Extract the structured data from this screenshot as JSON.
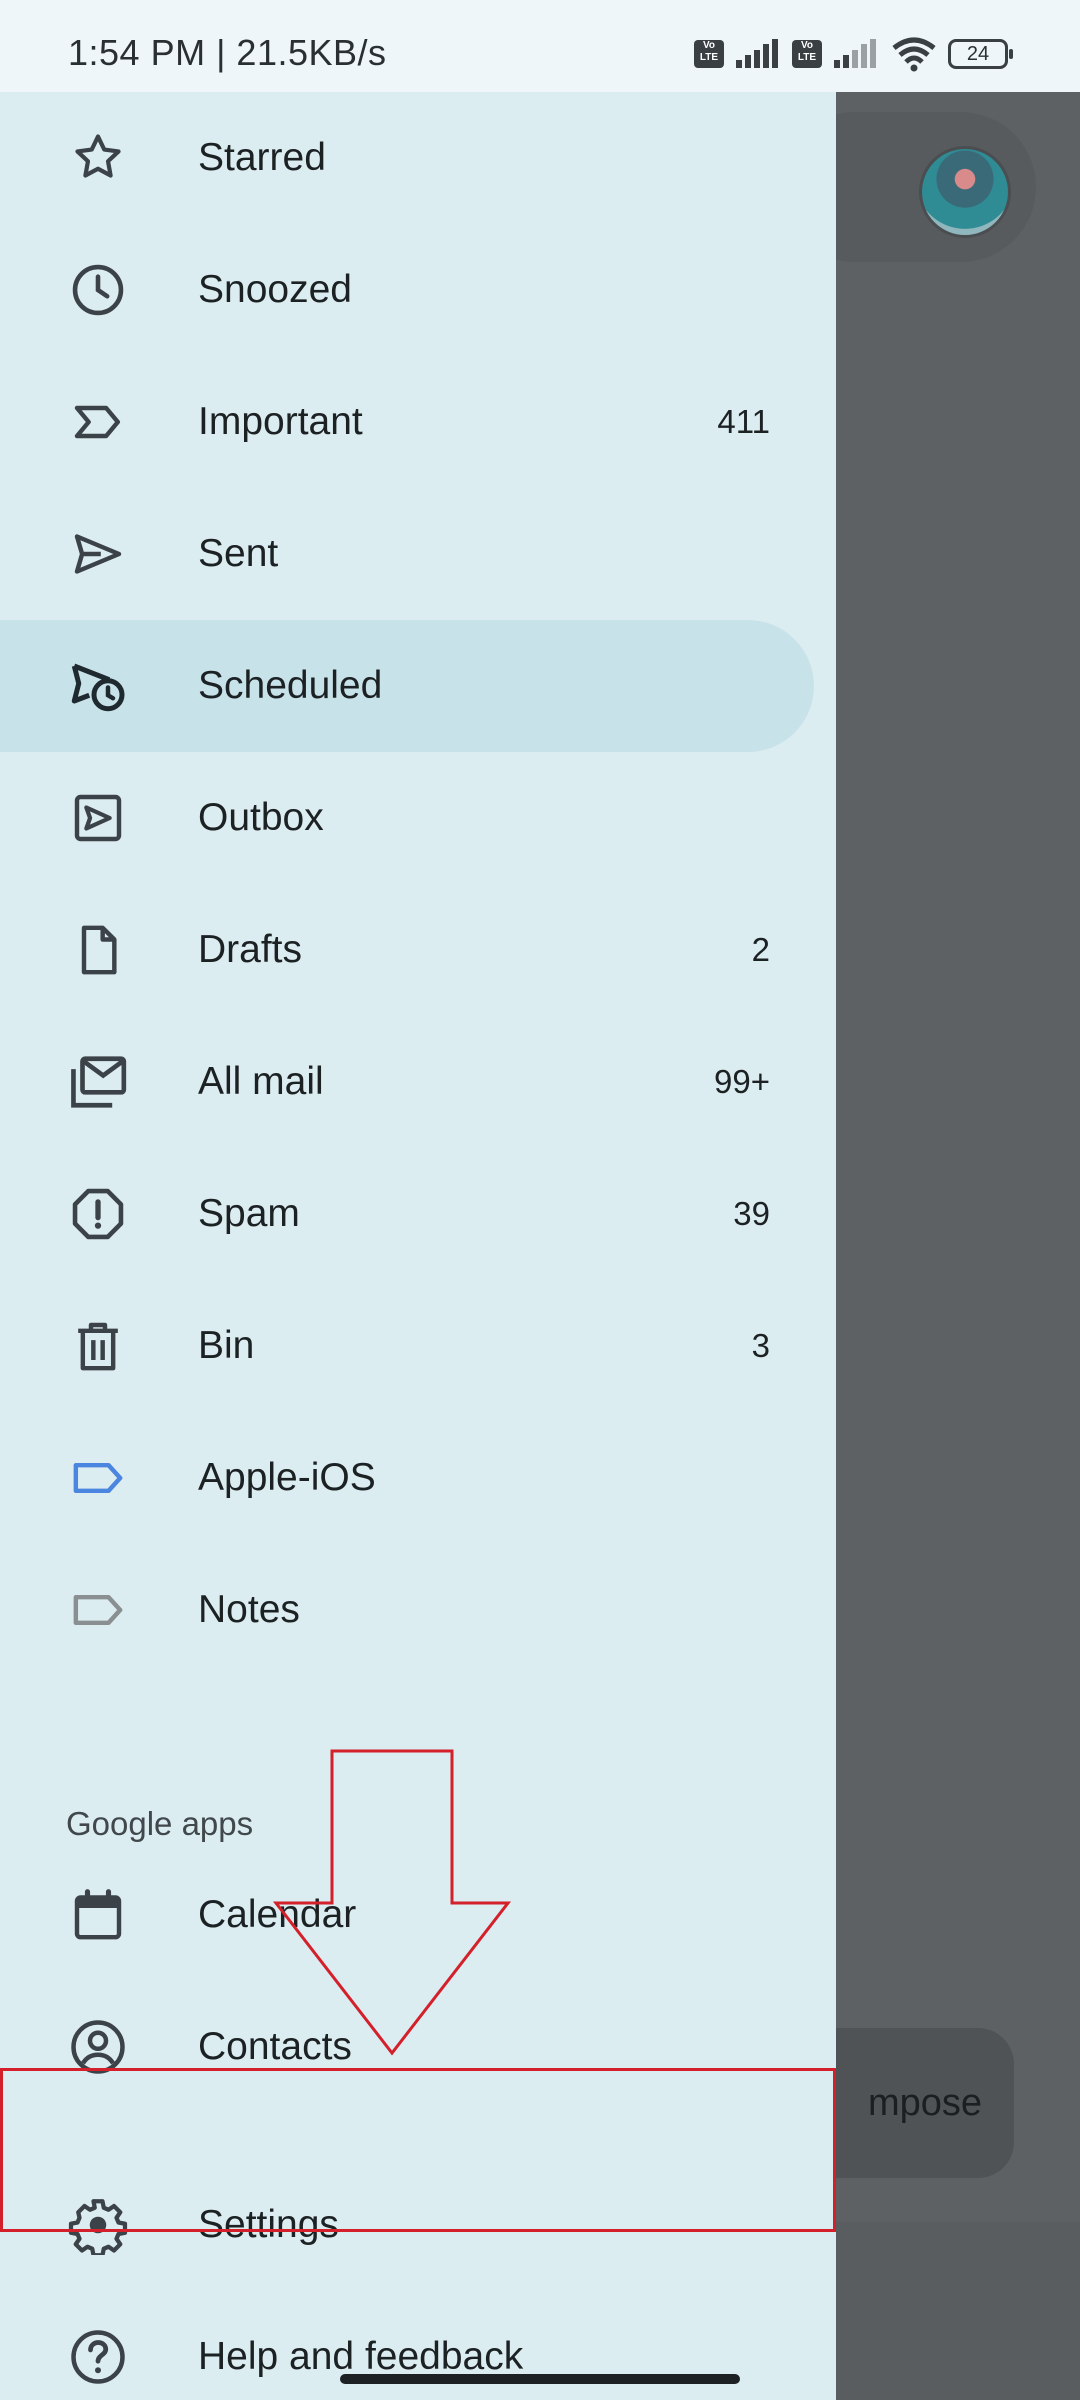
{
  "status_bar": {
    "time": "1:54 PM | 21.5KB/s",
    "lte1": "Vo LTE",
    "lte2": "Vo LTE",
    "battery": "24"
  },
  "drawer": {
    "items": [
      {
        "label": "Starred",
        "icon": "star-icon",
        "count": ""
      },
      {
        "label": "Snoozed",
        "icon": "clock-icon",
        "count": ""
      },
      {
        "label": "Important",
        "icon": "important-icon",
        "count": "411"
      },
      {
        "label": "Sent",
        "icon": "send-icon",
        "count": ""
      },
      {
        "label": "Scheduled",
        "icon": "scheduled-send-icon",
        "count": "",
        "selected": true
      },
      {
        "label": "Outbox",
        "icon": "outbox-icon",
        "count": ""
      },
      {
        "label": "Drafts",
        "icon": "draft-icon",
        "count": "2"
      },
      {
        "label": "All mail",
        "icon": "all-mail-icon",
        "count": "99+"
      },
      {
        "label": "Spam",
        "icon": "spam-icon",
        "count": "39"
      },
      {
        "label": "Bin",
        "icon": "trash-icon",
        "count": "3"
      },
      {
        "label": "Apple-iOS",
        "icon": "label-icon",
        "count": "",
        "color": "#4a86e0"
      },
      {
        "label": "Notes",
        "icon": "label-icon",
        "count": "",
        "color": "#8a8f92"
      }
    ],
    "section_title": "Google apps",
    "apps": [
      {
        "label": "Calendar",
        "icon": "calendar-icon"
      },
      {
        "label": "Contacts",
        "icon": "contacts-icon"
      },
      {
        "label": "Settings",
        "icon": "gear-icon"
      },
      {
        "label": "Help and feedback",
        "icon": "help-icon"
      }
    ]
  },
  "background": {
    "compose_label": "mpose"
  },
  "annotation": {
    "color": "#d4202b"
  }
}
